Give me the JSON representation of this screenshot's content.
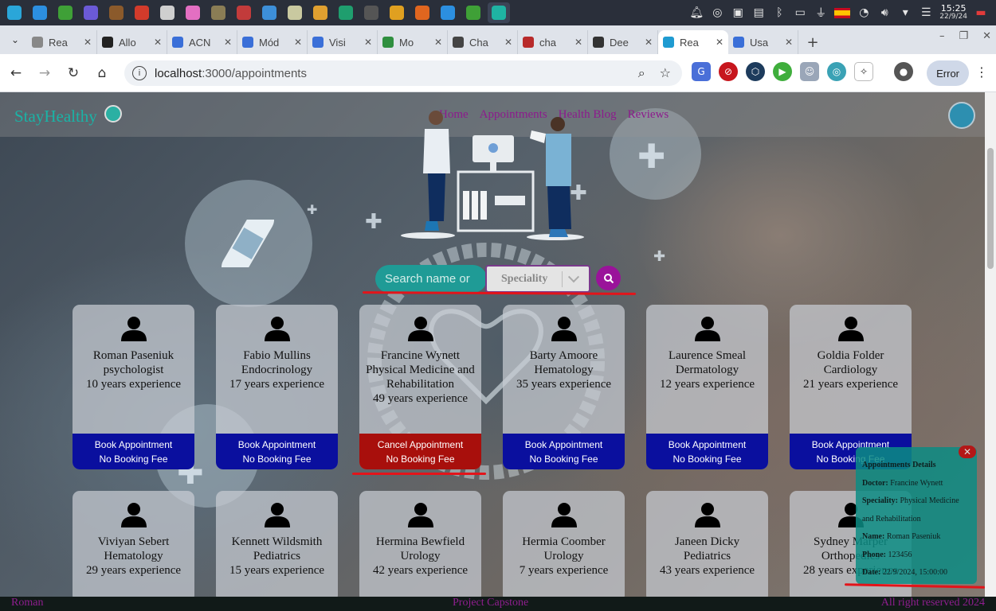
{
  "taskbar": {
    "apps": [
      {
        "icon": "network-icon",
        "color": "#2aa6d9"
      },
      {
        "icon": "vscode-icon",
        "color": "#2c8fe0"
      },
      {
        "icon": "mongodb-icon",
        "color": "#3fa037"
      },
      {
        "icon": "app-moon-icon",
        "color": "#6b5ad6"
      },
      {
        "icon": "minecraft-icon",
        "color": "#8b5a2b"
      },
      {
        "icon": "app-red-icon",
        "color": "#d23b2b"
      },
      {
        "icon": "app-camera-icon",
        "color": "#cfcfcf"
      },
      {
        "icon": "app-color-icon",
        "color": "#e36fc2"
      },
      {
        "icon": "gimp-icon",
        "color": "#8a7d55"
      },
      {
        "icon": "app-book-icon",
        "color": "#c23b3b"
      },
      {
        "icon": "app-disc-icon",
        "color": "#3d8fd8"
      },
      {
        "icon": "files-icon",
        "color": "#c9c9a0"
      },
      {
        "icon": "app-palette-icon",
        "color": "#e0a030"
      },
      {
        "icon": "app-green-icon",
        "color": "#1f9e6e"
      },
      {
        "icon": "terminal-icon",
        "color": "#555"
      },
      {
        "icon": "chrome-icon",
        "color": "#e0a020"
      },
      {
        "icon": "firefox-icon",
        "color": "#e0661f"
      },
      {
        "icon": "vscode-icon",
        "color": "#2c8fe0"
      },
      {
        "icon": "mongodb-icon",
        "color": "#3fa037"
      },
      {
        "icon": "app-teal-icon",
        "color": "#1fb3a3"
      }
    ],
    "time": "15:25",
    "date": "22/9/24"
  },
  "tabs": [
    {
      "label": "Rea",
      "fav_color": "#888888",
      "icon": "loading-icon"
    },
    {
      "label": "Allo",
      "fav_color": "#222222",
      "icon": "github-icon"
    },
    {
      "label": "ACN",
      "fav_color": "#3a6fd8",
      "icon": "c-icon"
    },
    {
      "label": "Mód",
      "fav_color": "#3a6fd8",
      "icon": "c-icon"
    },
    {
      "label": "Visi",
      "fav_color": "#3a6fd8",
      "icon": "c-icon"
    },
    {
      "label": "Mo",
      "fav_color": "#2f8f3f",
      "icon": "leaf-icon"
    },
    {
      "label": "Cha",
      "fav_color": "#444444",
      "icon": "openai-icon"
    },
    {
      "label": "cha",
      "fav_color": "#b82a2a",
      "icon": "app-tab-icon"
    },
    {
      "label": "Dee",
      "fav_color": "#333333",
      "icon": "deepl-icon"
    },
    {
      "label": "Rea",
      "fav_color": "#1f9bd1",
      "icon": "react-icon",
      "active": true
    },
    {
      "label": "Usa",
      "fav_color": "#3a6fd8",
      "icon": "app-tab-icon"
    }
  ],
  "address": {
    "host": "localhost",
    "path": ":3000/appointments"
  },
  "browser": {
    "error_label": "Error"
  },
  "site": {
    "logo": "StayHealthy",
    "nav": [
      "Home",
      "Appointments",
      "Health Blog",
      "Reviews"
    ]
  },
  "search": {
    "placeholder": "Search name or",
    "speciality": "Speciality"
  },
  "doctors": [
    {
      "name": "Roman Paseniuk",
      "speciality": "psychologist",
      "experience": "10 years experience",
      "action": "Book Appointment",
      "fee": "No Booking Fee",
      "booked": false
    },
    {
      "name": "Fabio Mullins",
      "speciality": "Endocrinology",
      "experience": "17 years experience",
      "action": "Book Appointment",
      "fee": "No Booking Fee",
      "booked": false
    },
    {
      "name": "Francine Wynett",
      "speciality": "Physical Medicine and Rehabilitation",
      "experience": "49 years experience",
      "action": "Cancel Appointment",
      "fee": "No Booking Fee",
      "booked": true
    },
    {
      "name": "Barty Amoore",
      "speciality": "Hematology",
      "experience": "35 years experience",
      "action": "Book Appointment",
      "fee": "No Booking Fee",
      "booked": false
    },
    {
      "name": "Laurence Smeal",
      "speciality": "Dermatology",
      "experience": "12 years experience",
      "action": "Book Appointment",
      "fee": "No Booking Fee",
      "booked": false
    },
    {
      "name": "Goldia Folder",
      "speciality": "Cardiology",
      "experience": "21 years experience",
      "action": "Book Appointment",
      "fee": "No Booking Fee",
      "booked": false
    },
    {
      "name": "Viviyan Sebert",
      "speciality": "Hematology",
      "experience": "29 years experience"
    },
    {
      "name": "Kennett Wildsmith",
      "speciality": "Pediatrics",
      "experience": "15 years experience"
    },
    {
      "name": "Hermina Bewfield",
      "speciality": "Urology",
      "experience": "42 years experience"
    },
    {
      "name": "Hermia Coomber",
      "speciality": "Urology",
      "experience": "7 years experience"
    },
    {
      "name": "Janeen Dicky",
      "speciality": "Pediatrics",
      "experience": "43 years experience"
    },
    {
      "name": "Sydney Marper",
      "speciality": "Orthopedics",
      "experience": "28 years experience"
    }
  ],
  "details": {
    "title": "Appointments Details",
    "doctor_label": "Doctor:",
    "doctor": "Francine Wynett",
    "speciality_label": "Speciality:",
    "speciality": "Physical Medicine and Rehabilitation",
    "name_label": "Name:",
    "name": "Roman Paseniuk",
    "phone_label": "Phone:",
    "phone": "123456",
    "date_label": "Date:",
    "date": "22/9/2024, 15:00:00"
  },
  "footer": {
    "left": "Roman",
    "center": "Project Capstone",
    "right": "All right reserved 2024"
  },
  "colors": {
    "brand": "#1ab3a6",
    "nav_link": "#8d1a8d",
    "book": "#0a0f9e",
    "cancel": "#a80f0c",
    "annotation": "#e3141a"
  }
}
